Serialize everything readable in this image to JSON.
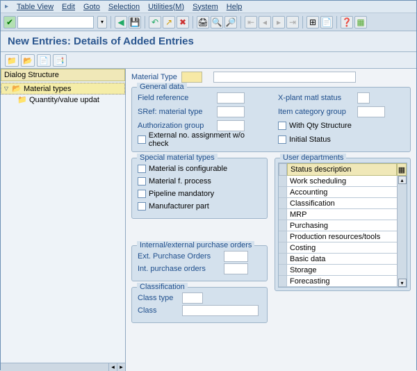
{
  "menu": [
    "Table View",
    "Edit",
    "Goto",
    "Selection",
    "Utilities(M)",
    "System",
    "Help"
  ],
  "page_title": "New Entries: Details of Added Entries",
  "dialog_header": "Dialog Structure",
  "tree": {
    "root": "Material types",
    "child": "Quantity/value updat"
  },
  "top_field": {
    "material_type_label": "Material Type"
  },
  "groups": {
    "general": {
      "title": "General data",
      "field_reference": "Field reference",
      "sref": "SRef: material type",
      "auth_group": "Authorization group",
      "ext_no": "External no. assignment w/o check",
      "xplant": "X-plant matl status",
      "item_cat": "Item category group",
      "with_qty": "With Qty Structure",
      "initial_status": "Initial Status"
    },
    "special": {
      "title": "Special material types",
      "configurable": "Material is configurable",
      "process": "Material f. process",
      "pipeline": "Pipeline mandatory",
      "manufacturer": "Manufacturer part"
    },
    "user_dept": {
      "title": "User departments",
      "header": "Status description",
      "rows": [
        "Work scheduling",
        "Accounting",
        "Classification",
        "MRP",
        "Purchasing",
        "Production resources/tools",
        "Costing",
        "Basic data",
        "Storage",
        "Forecasting"
      ]
    },
    "intext": {
      "title": "Internal/external purchase orders",
      "ext": "Ext. Purchase Orders",
      "int": "Int. purchase orders"
    },
    "classification": {
      "title": "Classification",
      "class_type": "Class type",
      "class": "Class"
    }
  },
  "icons": {
    "green_check": "✔",
    "save": "💾",
    "back": "◀",
    "forward": "▶"
  }
}
